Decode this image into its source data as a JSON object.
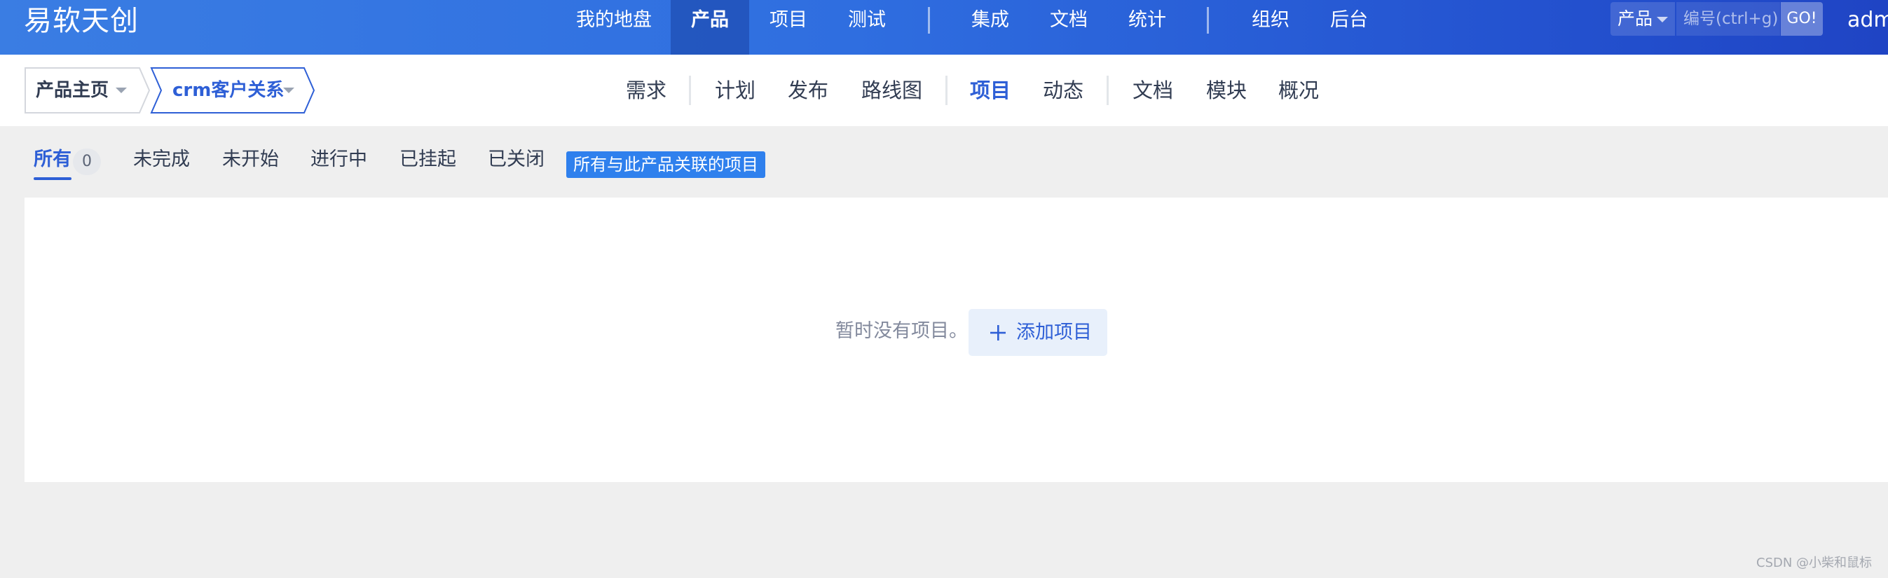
{
  "brand": "易软天创",
  "main_nav": {
    "items": [
      {
        "label": "我的地盘"
      },
      {
        "label": "产品"
      },
      {
        "label": "项目"
      },
      {
        "label": "测试"
      },
      {
        "label": "集成"
      },
      {
        "label": "文档"
      },
      {
        "label": "统计"
      },
      {
        "label": "组织"
      },
      {
        "label": "后台"
      }
    ],
    "active": "产品"
  },
  "search": {
    "type_label": "产品",
    "placeholder": "编号(ctrl+g)",
    "go_label": "GO!"
  },
  "user": "adm",
  "breadcrumb": {
    "home": "产品主页",
    "current": "crm客户关系"
  },
  "sub_nav": {
    "items": [
      {
        "label": "需求"
      },
      {
        "label": "计划"
      },
      {
        "label": "发布"
      },
      {
        "label": "路线图"
      },
      {
        "label": "项目"
      },
      {
        "label": "动态"
      },
      {
        "label": "文档"
      },
      {
        "label": "模块"
      },
      {
        "label": "概况"
      }
    ],
    "active": "项目"
  },
  "feature_bar": {
    "tabs": [
      {
        "label": "所有",
        "count": "0"
      },
      {
        "label": "未完成"
      },
      {
        "label": "未开始"
      },
      {
        "label": "进行中"
      },
      {
        "label": "已挂起"
      },
      {
        "label": "已关闭"
      }
    ],
    "active": "所有",
    "tag": "所有与此产品关联的项目"
  },
  "empty_state": {
    "message": "暂时没有项目。",
    "add_button": "添加项目"
  },
  "watermark": "CSDN @小柴和鼠标",
  "colors": {
    "header_gradient_start": "#3a7de3",
    "header_gradient_end": "#1f44c4",
    "accent": "#2e5fd6",
    "tag_bg": "#2f80ed",
    "page_bg": "#efefef"
  },
  "icons": [
    "caret-down-icon",
    "plus-icon"
  ]
}
